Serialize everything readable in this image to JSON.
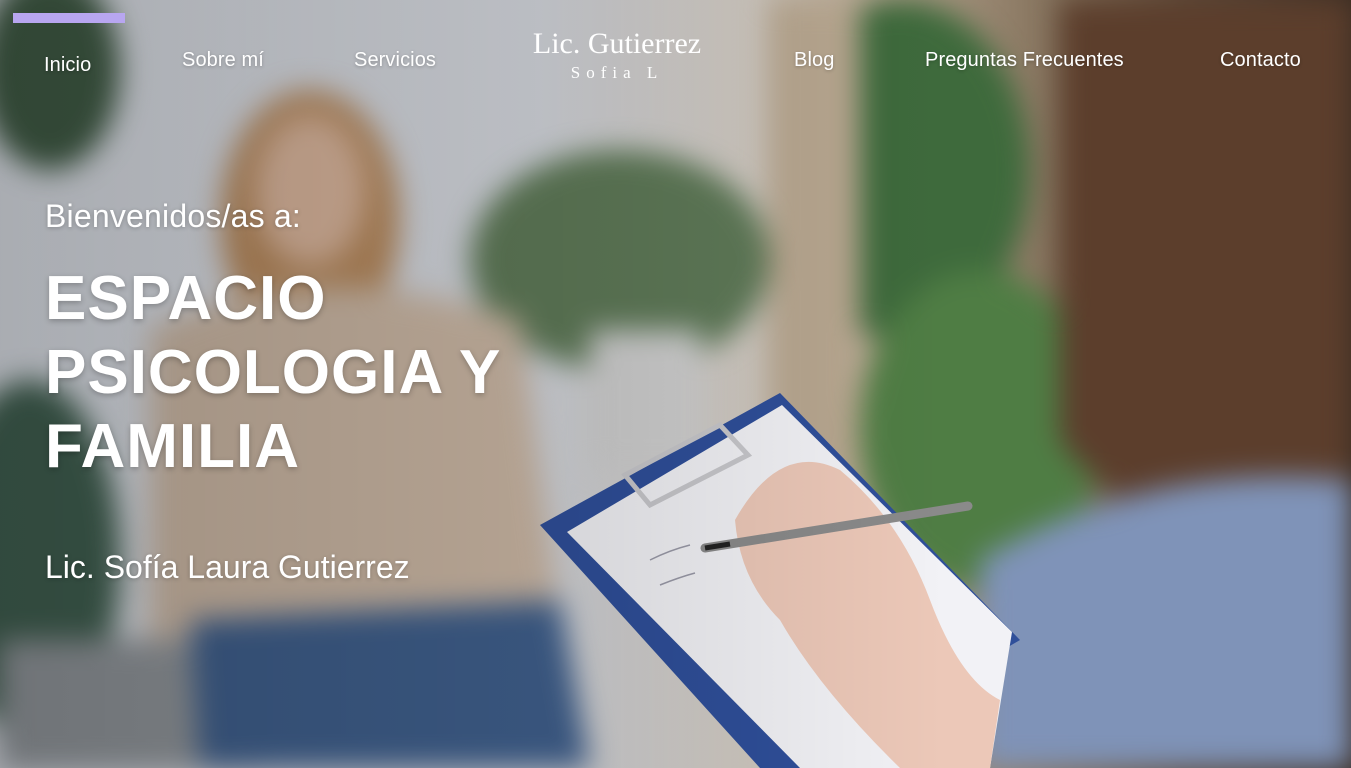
{
  "nav": {
    "items": [
      {
        "label": "Inicio",
        "active": true
      },
      {
        "label": "Sobre mí"
      },
      {
        "label": "Servicios"
      },
      {
        "label": "Blog"
      },
      {
        "label": "Preguntas Frecuentes"
      },
      {
        "label": "Contacto"
      }
    ],
    "active_indicator_color": "#b8a6f0"
  },
  "logo": {
    "line1": "Lic. Gutierrez",
    "line2": "Sofia L"
  },
  "hero": {
    "welcome": "Bienvenidos/as a:",
    "headline_lines": [
      "ESPACIO",
      "PSICOLOGIA Y",
      "FAMILIA"
    ],
    "name": "Lic. Sofía Laura Gutierrez"
  }
}
